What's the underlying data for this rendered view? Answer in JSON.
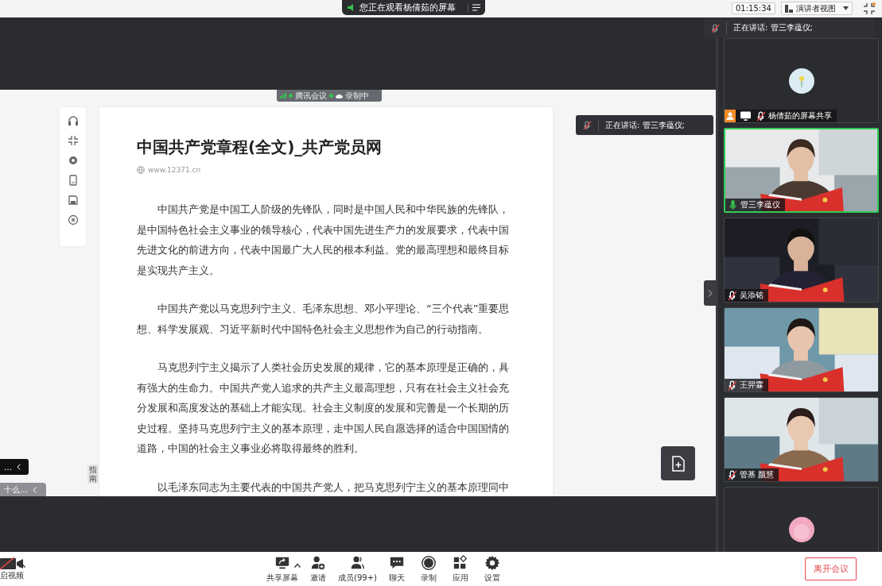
{
  "top_bar": {
    "banner": "您正在观看杨倩茹的屏幕",
    "timer": "01:15:34",
    "view_mode": "演讲者视图"
  },
  "speaking_banner": "正在讲话: 管三李蕴仪;",
  "shared_screen": {
    "status_pill": {
      "app": "腾讯会议",
      "recording": "录制中"
    },
    "document": {
      "title": "中国共产党章程(全文)_共产党员网",
      "source": "www.12371.cn",
      "paragraphs": [
        "中国共产党是中国工人阶级的先锋队，同时是中国人民和中华民族的先锋队，是中国特色社会主义事业的领导核心，代表中国先进生产力的发展要求，代表中国先进文化的前进方向，代表中国最广大人民的根本利益。党的最高理想和最终目标是实现共产主义。",
        "中国共产党以马克思列宁主义、毛泽东思想、邓小平理论、“三个代表”重要思想、科学发展观、习近平新时代中国特色社会主义思想作为自己的行动指南。",
        "马克思列宁主义揭示了人类社会历史发展的规律，它的基本原理是正确的，具有强大的生命力。中国共产党人追求的共产主义最高理想，只有在社会主义社会充分发展和高度发达的基础上才能实现。社会主义制度的发展和完善是一个长期的历史过程。坚持马克思列宁主义的基本原理，走中国人民自愿选择的适合中国国情的道路，中国的社会主义事业必将取得最终的胜利。",
        "以毛泽东同志为主要代表的中国共产党人，把马克思列宁主义的基本原理同中"
      ]
    },
    "speaking_toast": "正在讲话: 管三李蕴仪;",
    "side_tabs": [
      {
        "label": "…",
        "kind": "dark"
      },
      {
        "label": "十么…",
        "kind": "light"
      }
    ],
    "guide_tab": "指南"
  },
  "participants": [
    {
      "kind": "avatar",
      "name": "杨倩茹的屏幕共享",
      "sharing": true,
      "speaking": false,
      "muted": true
    },
    {
      "kind": "video",
      "name": "管三李蕴仪",
      "sharing": false,
      "speaking": true,
      "muted": false
    },
    {
      "kind": "video",
      "name": "吴添铭",
      "sharing": false,
      "speaking": false,
      "muted": true
    },
    {
      "kind": "video",
      "name": "王羿霖",
      "sharing": false,
      "speaking": false,
      "muted": true
    },
    {
      "kind": "video",
      "name": "管基 颜慧",
      "sharing": false,
      "speaking": false,
      "muted": true
    },
    {
      "kind": "avatar",
      "speaking": false
    }
  ],
  "toolbar": {
    "video": "启视频",
    "buttons": [
      {
        "kind": "share",
        "label": "共享屏幕"
      },
      {
        "kind": "invite",
        "label": "邀请"
      },
      {
        "kind": "members",
        "label": "成员(99+)"
      },
      {
        "kind": "chat",
        "label": "聊天"
      },
      {
        "kind": "record",
        "label": "录制"
      },
      {
        "kind": "apps",
        "label": "应用"
      },
      {
        "kind": "settings",
        "label": "设置"
      }
    ],
    "leave": "离开会议"
  }
}
